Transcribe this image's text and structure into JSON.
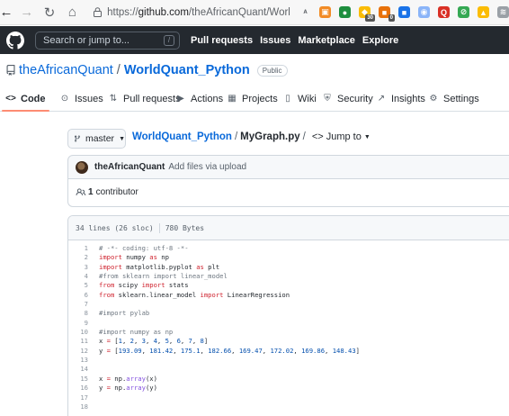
{
  "browser": {
    "url_scheme": "https://",
    "url_host": "github.com",
    "url_path": "/theAfricanQuant/WorldQuant...",
    "extensions": [
      {
        "name": "reader-icon",
        "color": "#5f6368",
        "glyph": "ᴬ"
      },
      {
        "name": "extension-orange",
        "color": "#f28b25",
        "glyph": "▣"
      },
      {
        "name": "extension-green",
        "color": "#1e8e3e",
        "glyph": "●"
      },
      {
        "name": "extension-multicolor",
        "color": "#fbbc04",
        "glyph": "◆",
        "badge": "30"
      },
      {
        "name": "extension-orange2",
        "color": "#e8710a",
        "glyph": "■",
        "badge": "0"
      },
      {
        "name": "extension-blue",
        "color": "#1a73e8",
        "glyph": "■"
      },
      {
        "name": "extension-color",
        "color": "#8ab4f8",
        "glyph": "◉"
      },
      {
        "name": "extension-q",
        "color": "#d93025",
        "glyph": "Q"
      },
      {
        "name": "extension-lime",
        "color": "#34a853",
        "glyph": "⊘"
      },
      {
        "name": "extension-drive",
        "color": "#fbbc04",
        "glyph": "▲"
      },
      {
        "name": "extension-gray",
        "color": "#9aa0a6",
        "glyph": "≋"
      }
    ]
  },
  "github": {
    "search_placeholder": "Search or jump to...",
    "search_key": "/",
    "nav": [
      "Pull requests",
      "Issues",
      "Marketplace",
      "Explore"
    ]
  },
  "repo": {
    "owner": "theAfricanQuant",
    "separator": "/",
    "name": "WorldQuant_Python",
    "visibility": "Public"
  },
  "tabs": [
    {
      "label": "Code",
      "icon": "code-icon",
      "glyph": "<>",
      "active": true
    },
    {
      "label": "Issues",
      "icon": "issue-icon",
      "glyph": "⊙",
      "active": false
    },
    {
      "label": "Pull requests",
      "icon": "pull-request-icon",
      "glyph": "⇅",
      "active": false
    },
    {
      "label": "Actions",
      "icon": "actions-icon",
      "glyph": "▶",
      "active": false
    },
    {
      "label": "Projects",
      "icon": "projects-icon",
      "glyph": "▦",
      "active": false
    },
    {
      "label": "Wiki",
      "icon": "wiki-icon",
      "glyph": "▯",
      "active": false
    },
    {
      "label": "Security",
      "icon": "shield-icon",
      "glyph": "⛨",
      "active": false
    },
    {
      "label": "Insights",
      "icon": "graph-icon",
      "glyph": "↗",
      "active": false
    },
    {
      "label": "Settings",
      "icon": "gear-icon",
      "glyph": "⚙",
      "active": false
    }
  ],
  "file_nav": {
    "branch": "master",
    "repo_crumb": "WorldQuant_Python",
    "sep": "/",
    "file": "MyGraph.py",
    "jump_sep": "/",
    "jump": "<> Jump to"
  },
  "commit": {
    "author": "theAfricanQuant",
    "message": "Add files via upload"
  },
  "contributors": {
    "count": "1",
    "label": "contributor"
  },
  "file_info": {
    "lines": "34 lines (26 sloc)",
    "size": "780 Bytes"
  },
  "code_lines": [
    {
      "n": "1",
      "t": [
        [
          "cm",
          "# -*- coding: utf-8 -*-"
        ]
      ]
    },
    {
      "n": "2",
      "t": [
        [
          "kw",
          "import"
        ],
        [
          "",
          " numpy "
        ],
        [
          "kw",
          "as"
        ],
        [
          "",
          " np"
        ]
      ]
    },
    {
      "n": "3",
      "t": [
        [
          "kw",
          "import"
        ],
        [
          "",
          " matplotlib.pyplot "
        ],
        [
          "kw",
          "as"
        ],
        [
          "",
          " plt"
        ]
      ]
    },
    {
      "n": "4",
      "t": [
        [
          "cm",
          "#from sklearn import linear_model"
        ]
      ]
    },
    {
      "n": "5",
      "t": [
        [
          "kw",
          "from"
        ],
        [
          "",
          " scipy "
        ],
        [
          "kw",
          "import"
        ],
        [
          "",
          " stats"
        ]
      ]
    },
    {
      "n": "6",
      "t": [
        [
          "kw",
          "from"
        ],
        [
          "",
          " sklearn.linear_model "
        ],
        [
          "kw",
          "import"
        ],
        [
          "",
          " LinearRegression"
        ]
      ]
    },
    {
      "n": "7",
      "t": []
    },
    {
      "n": "8",
      "t": [
        [
          "cm",
          "#import pylab"
        ]
      ]
    },
    {
      "n": "9",
      "t": []
    },
    {
      "n": "10",
      "t": [
        [
          "cm",
          "#import numpy as np"
        ]
      ]
    },
    {
      "n": "11",
      "t": [
        [
          "",
          "x "
        ],
        [
          "kw",
          "="
        ],
        [
          "",
          " ["
        ],
        [
          "num",
          "1"
        ],
        [
          "",
          ", "
        ],
        [
          "num",
          "2"
        ],
        [
          "",
          ", "
        ],
        [
          "num",
          "3"
        ],
        [
          "",
          ", "
        ],
        [
          "num",
          "4"
        ],
        [
          "",
          ", "
        ],
        [
          "num",
          "5"
        ],
        [
          "",
          ", "
        ],
        [
          "num",
          "6"
        ],
        [
          "",
          ", "
        ],
        [
          "num",
          "7"
        ],
        [
          "",
          ", "
        ],
        [
          "num",
          "8"
        ],
        [
          "",
          "]"
        ]
      ]
    },
    {
      "n": "12",
      "t": [
        [
          "",
          "y "
        ],
        [
          "kw",
          "="
        ],
        [
          "",
          " ["
        ],
        [
          "num",
          "193.09"
        ],
        [
          "",
          ", "
        ],
        [
          "num",
          "181.42"
        ],
        [
          "",
          ", "
        ],
        [
          "num",
          "175.1"
        ],
        [
          "",
          ", "
        ],
        [
          "num",
          "182.66"
        ],
        [
          "",
          ", "
        ],
        [
          "num",
          "169.47"
        ],
        [
          "",
          ", "
        ],
        [
          "num",
          "172.02"
        ],
        [
          "",
          ", "
        ],
        [
          "num",
          "169.86"
        ],
        [
          "",
          ", "
        ],
        [
          "num",
          "148.43"
        ],
        [
          "",
          "]"
        ]
      ]
    },
    {
      "n": "13",
      "t": []
    },
    {
      "n": "14",
      "t": []
    },
    {
      "n": "15",
      "t": [
        [
          "",
          "x "
        ],
        [
          "kw",
          "="
        ],
        [
          "",
          " np."
        ],
        [
          "fn",
          "array"
        ],
        [
          "",
          "(x)"
        ]
      ]
    },
    {
      "n": "16",
      "t": [
        [
          "",
          "y "
        ],
        [
          "kw",
          "="
        ],
        [
          "",
          " np."
        ],
        [
          "fn",
          "array"
        ],
        [
          "",
          "(y)"
        ]
      ]
    },
    {
      "n": "17",
      "t": []
    },
    {
      "n": "18",
      "t": []
    }
  ]
}
